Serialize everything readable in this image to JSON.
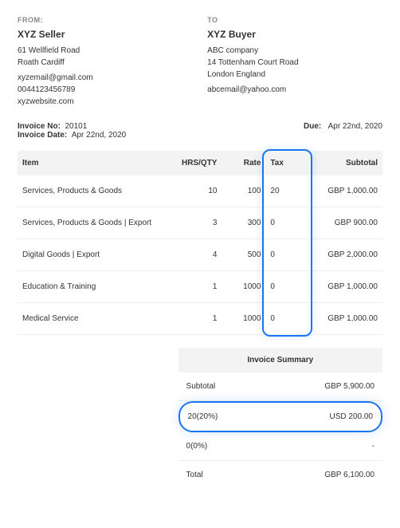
{
  "from": {
    "label": "FROM:",
    "name": "XYZ Seller",
    "addr1": "61 Wellfield Road",
    "addr2": "Roath Cardiff",
    "email": "xyzemail@gmail.com",
    "phone": "0044123456789",
    "website": "xyzwebsite.com"
  },
  "to": {
    "label": "TO",
    "name": "XYZ Buyer",
    "company": "ABC company",
    "addr1": "14 Tottenham Court Road",
    "addr2": "London England",
    "email": "abcemail@yahoo.com"
  },
  "meta": {
    "invoice_no_label": "Invoice No:",
    "invoice_no": "20101",
    "invoice_date_label": "Invoice Date:",
    "invoice_date": "Apr 22nd, 2020",
    "due_label": "Due:",
    "due": "Apr 22nd, 2020"
  },
  "table": {
    "headers": {
      "item": "Item",
      "qty": "HRS/QTY",
      "rate": "Rate",
      "tax": "Tax",
      "subtotal": "Subtotal"
    },
    "rows": [
      {
        "item": "Services, Products & Goods",
        "qty": "10",
        "rate": "100",
        "tax": "20",
        "subtotal": "GBP 1,000.00"
      },
      {
        "item": "Services, Products & Goods | Export",
        "qty": "3",
        "rate": "300",
        "tax": "0",
        "subtotal": "GBP 900.00"
      },
      {
        "item": "Digital Goods | Export",
        "qty": "4",
        "rate": "500",
        "tax": "0",
        "subtotal": "GBP 2,000.00"
      },
      {
        "item": "Education & Training",
        "qty": "1",
        "rate": "1000",
        "tax": "0",
        "subtotal": "GBP 1,000.00"
      },
      {
        "item": "Medical Service",
        "qty": "1",
        "rate": "1000",
        "tax": "0",
        "subtotal": "GBP 1,000.00"
      }
    ]
  },
  "summary": {
    "title": "Invoice Summary",
    "subtotal_label": "Subtotal",
    "subtotal": "GBP 5,900.00",
    "tax20_label": "20(20%)",
    "tax20": "USD 200.00",
    "tax0_label": "0(0%)",
    "tax0": "-",
    "total_label": "Total",
    "total": "GBP 6,100.00"
  }
}
